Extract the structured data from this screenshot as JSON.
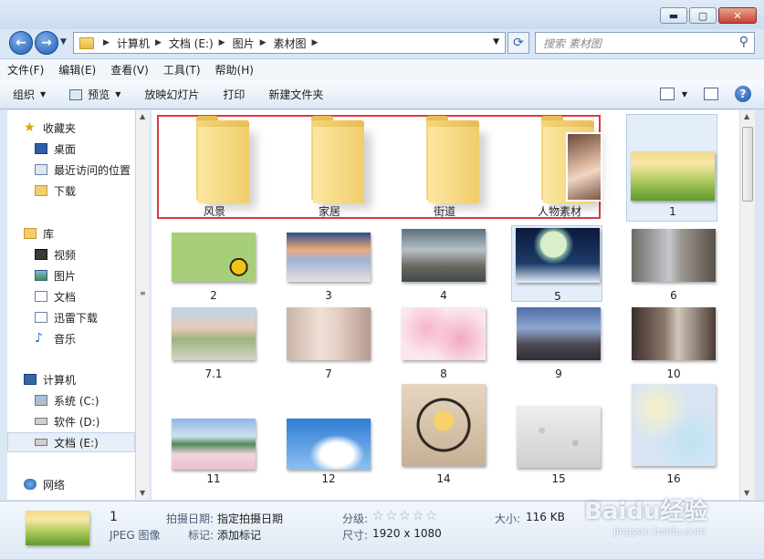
{
  "window": {
    "min": "▬",
    "max": "▢",
    "close": "✕"
  },
  "address": {
    "crumbs": [
      "计算机",
      "文档 (E:)",
      "图片",
      "素材图"
    ],
    "search_placeholder": "搜索 素材图"
  },
  "menu": [
    "文件(F)",
    "编辑(E)",
    "查看(V)",
    "工具(T)",
    "帮助(H)"
  ],
  "toolbar": {
    "organize": "组织",
    "preview": "预览",
    "slideshow": "放映幻灯片",
    "print": "打印",
    "new_folder": "新建文件夹"
  },
  "nav": {
    "favorites": "收藏夹",
    "desktop": "桌面",
    "recent": "最近访问的位置",
    "downloads": "下载",
    "libraries": "库",
    "videos": "视频",
    "pictures": "图片",
    "documents": "文档",
    "xunlei": "迅雷下载",
    "music": "音乐",
    "computer": "计算机",
    "drive_c": "系统 (C:)",
    "drive_d": "软件 (D:)",
    "drive_e": "文档 (E:)",
    "network": "网络"
  },
  "folders": [
    "风景",
    "家居",
    "街道",
    "人物素材"
  ],
  "files": [
    "1",
    "2",
    "3",
    "4",
    "5",
    "6",
    "7.1",
    "7",
    "8",
    "9",
    "10",
    "11",
    "12",
    "14",
    "15",
    "16"
  ],
  "status": {
    "name": "1",
    "type": "JPEG 图像",
    "date_label": "拍摄日期:",
    "date_value": "指定拍摄日期",
    "tags_label": "标记:",
    "tags_value": "添加标记",
    "rating_label": "分级:",
    "rating_stars": "☆☆☆☆☆",
    "dims_label": "尺寸:",
    "dims_value": "1920 x 1080",
    "size_label": "大小:",
    "size_value": "116 KB"
  },
  "watermark": {
    "main": "Baidu经验",
    "sub": "jingyan.baidu.com"
  }
}
